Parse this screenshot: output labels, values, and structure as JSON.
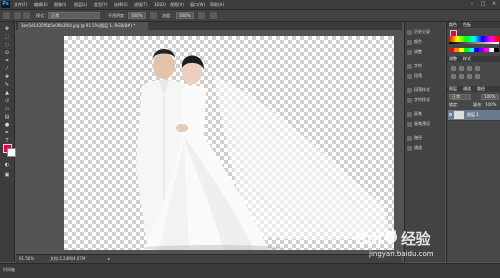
{
  "app": {
    "logo": "Ps"
  },
  "menu": {
    "items": [
      "文件(F)",
      "编辑(E)",
      "图像(I)",
      "图层(L)",
      "类型(Y)",
      "选择(S)",
      "滤镜(T)",
      "3D(D)",
      "视图(V)",
      "窗口(W)",
      "帮助(H)"
    ]
  },
  "options_bar": {
    "mode_label": "模式：",
    "mode_value": "正常",
    "opacity_label": "不透明度：",
    "opacity_value": "100%",
    "flow_label": "流量：",
    "flow_value": "100%"
  },
  "document": {
    "tab_title": "3ee5d1435f6b5e09b3f04.jpg @ 91.5%(图层 1, RGB/8#) *",
    "zoom": "91.56%",
    "doc_info": "文档:2.24M/4.07M"
  },
  "status_bar": {
    "text": "时间轴"
  },
  "dock": {
    "items": [
      "历史记录",
      "颜色",
      "调整",
      "字符",
      "段落",
      "段落样式",
      "字符样式",
      "画笔",
      "画笔预设",
      "路径",
      "通道"
    ]
  },
  "panels": {
    "color_tab": "颜色",
    "swatch_tab": "色板",
    "adjust_tab": "调整",
    "style_tab": "样式",
    "layers_tab": "图层",
    "channel_tab": "通道",
    "path_tab": "路径",
    "blend_mode": "正常",
    "opacity_label": "不透明度",
    "opacity_value": "100%",
    "lock_label": "锁定:",
    "fill_label": "填充:",
    "fill_value": "100%",
    "layer_name": "图层 1"
  },
  "colors": {
    "foreground": "#e8004a",
    "background": "#ffffff"
  },
  "watermark": {
    "logo": "Bai 经验",
    "url": "jingyan.baidu.com"
  }
}
